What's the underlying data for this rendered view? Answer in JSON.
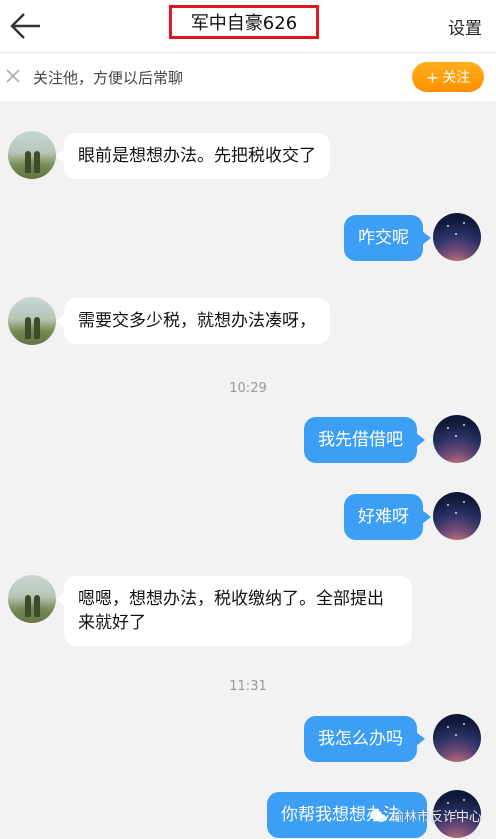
{
  "header": {
    "title": "军中自豪626",
    "settings_label": "设置"
  },
  "follow_bar": {
    "text": "关注他，方便以后常聊",
    "button_label": "关注",
    "button_color": "#ff9d0b"
  },
  "messages": [
    {
      "side": "left",
      "text": "眼前是想想办法。先把税收交了"
    },
    {
      "side": "right",
      "text": "咋交呢"
    },
    {
      "side": "left",
      "text": "需要交多少税，就想办法凑呀，"
    },
    {
      "side": "right",
      "text": "我先借借吧"
    },
    {
      "side": "right",
      "text": "好难呀"
    },
    {
      "side": "left",
      "text": "嗯嗯，想想办法，税收缴纳了。全部提出来就好了"
    },
    {
      "side": "right",
      "text": "我怎么办吗"
    },
    {
      "side": "right",
      "text": "你帮我想想办法"
    }
  ],
  "timestamps": [
    "10:29",
    "11:31"
  ],
  "watermark": {
    "text": "榆林市反诈中心"
  },
  "colors": {
    "accent": "#3d9ef5",
    "highlight_box": "#e0151e",
    "follow_button": "#ff9d0b"
  },
  "icons": {
    "back": "arrow-left-icon",
    "close": "close-icon",
    "plus": "plus-icon",
    "watermark": "wechat-icon"
  }
}
